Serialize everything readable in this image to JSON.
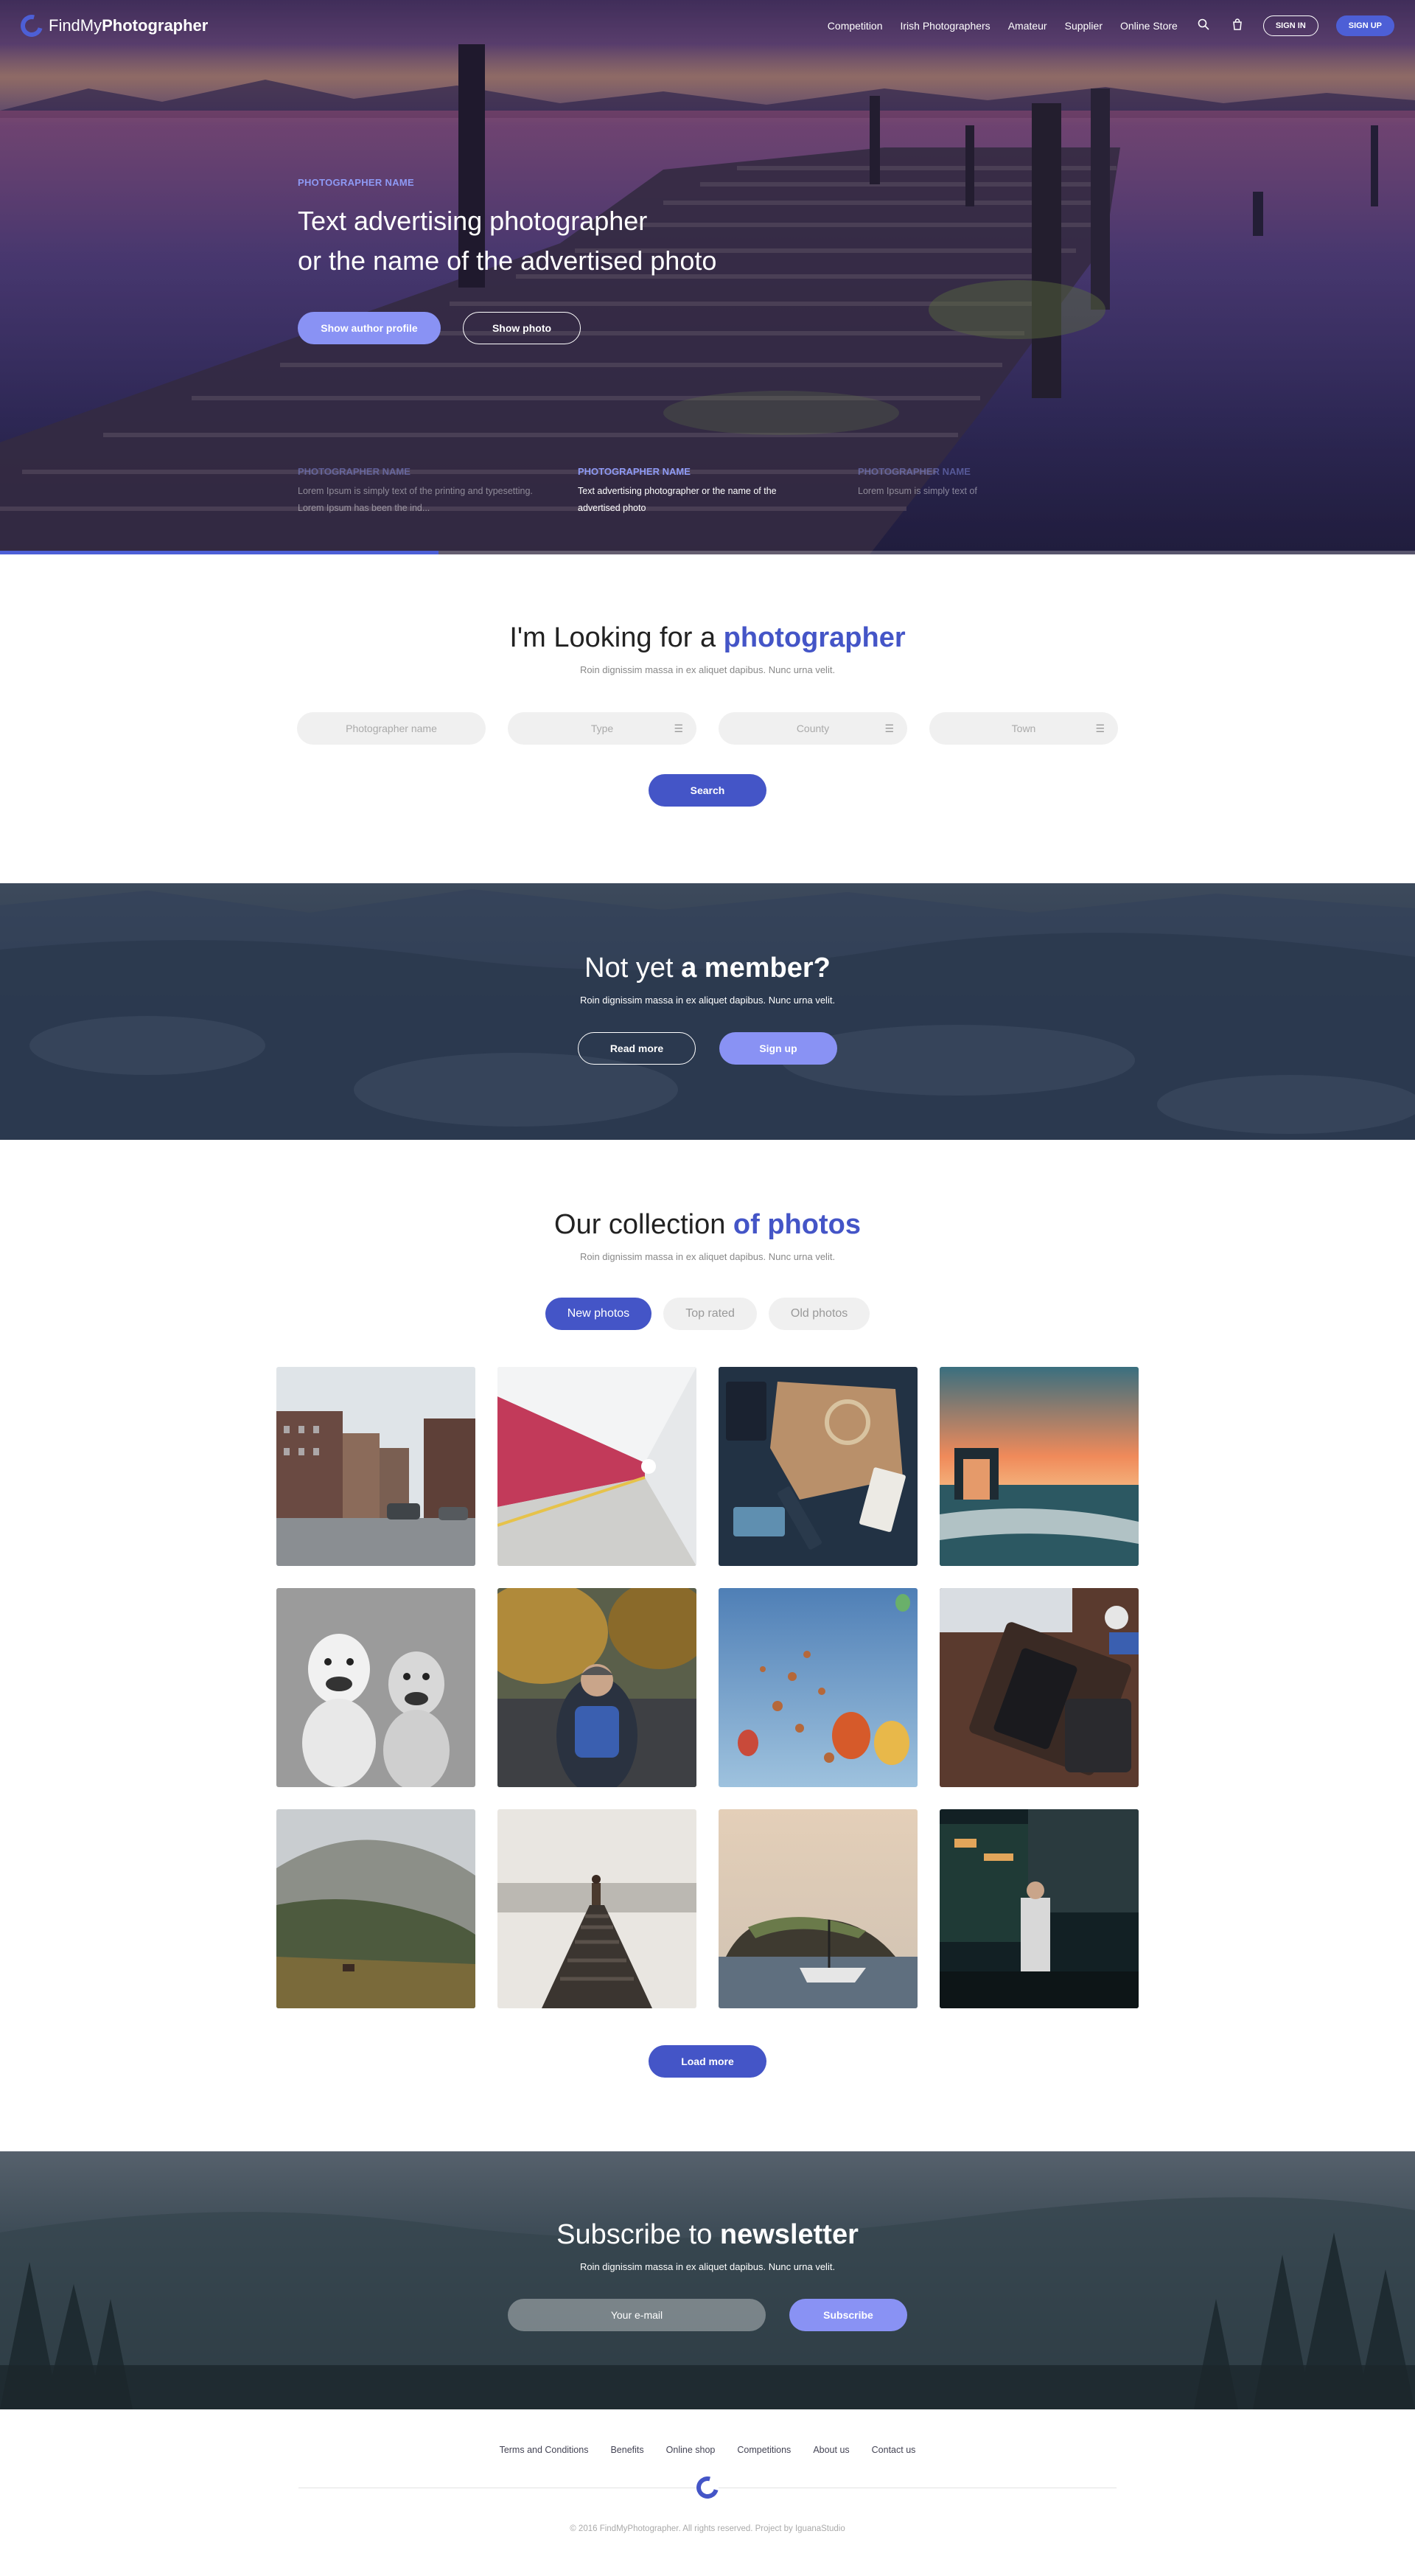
{
  "nav": {
    "logo_light": "FindMy",
    "logo_bold": "Photographer",
    "links": [
      "Competition",
      "Irish Photographers",
      "Amateur",
      "Supplier",
      "Online Store"
    ],
    "sign_in": "SIGN IN",
    "sign_up": "SIGN UP"
  },
  "hero": {
    "kicker": "PHOTOGRAPHER NAME",
    "title_line1": "Text advertising photographer",
    "title_line2": "or the name of the advertised photo",
    "btn_profile": "Show author profile",
    "btn_photo": "Show photo",
    "slides": [
      {
        "kicker": "PHOTOGRAPHER NAME",
        "text": "Lorem Ipsum is simply text of the printing and typesetting. Lorem Ipsum has been the ind..."
      },
      {
        "kicker": "PHOTOGRAPHER NAME",
        "text": "Text advertising photographer or the name of the advertised photo"
      },
      {
        "kicker": "PHOTOGRAPHER NAME",
        "text": "Lorem Ipsum is simply text of"
      }
    ],
    "progress": 0.31
  },
  "search": {
    "title_plain": "I'm Looking for a ",
    "title_accent": "photographer",
    "subtitle": "Roin dignissim massa in ex aliquet dapibus. Nunc urna velit.",
    "fields": [
      "Photographer name",
      "Type",
      "County",
      "Town"
    ],
    "button": "Search"
  },
  "member": {
    "title_plain": "Not yet ",
    "title_bold": "a member?",
    "subtitle": "Roin dignissim massa in ex aliquet dapibus. Nunc urna velit.",
    "read_more": "Read more",
    "sign_up": "Sign up"
  },
  "collection": {
    "title_plain": "Our collection ",
    "title_accent": "of photos",
    "subtitle": "Roin dignissim massa in ex aliquet dapibus. Nunc urna velit.",
    "tabs": [
      "New photos",
      "Top rated",
      "Old photos"
    ],
    "load_more": "Load more"
  },
  "newsletter": {
    "title_plain": "Subscribe to ",
    "title_bold": "newsletter",
    "subtitle": "Roin dignissim massa in ex aliquet dapibus. Nunc urna velit.",
    "email_placeholder": "Your e-mail",
    "button": "Subscribe"
  },
  "footer": {
    "links": [
      "Terms and Conditions",
      "Benefits",
      "Online shop",
      "Competitions",
      "About us",
      "Contact us"
    ],
    "copyright": "© 2016 FindMyPhotographer. All rights reserved. Project by IguanaStudio"
  },
  "colors": {
    "accent": "#4455c7",
    "accent_light": "#8992f4",
    "brand_blue": "#4d5fd6"
  }
}
